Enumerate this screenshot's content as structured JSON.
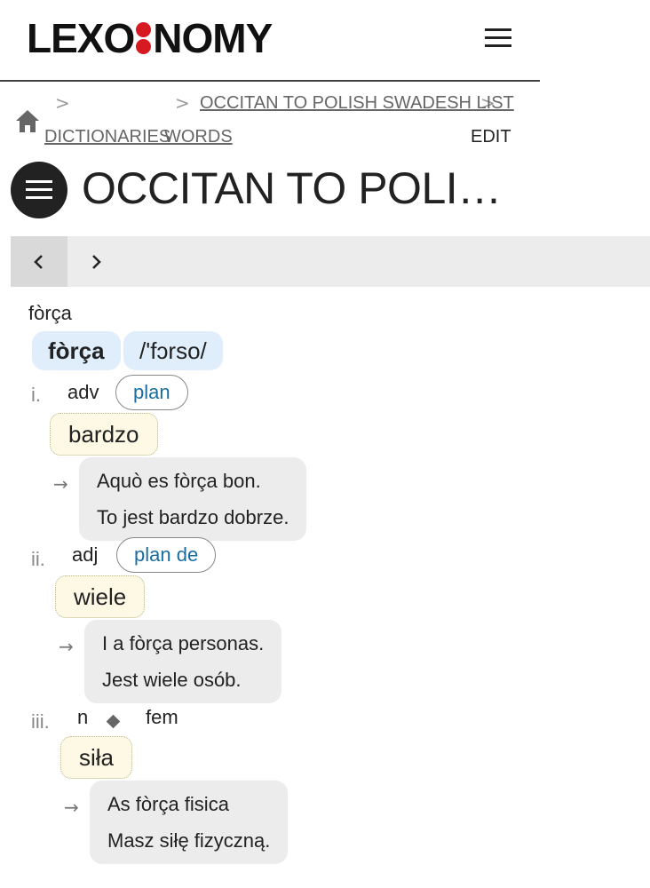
{
  "header": {
    "logo_left": "LEXO",
    "logo_right": "NOMY"
  },
  "breadcrumb": {
    "dictionaries": "DICTIONARIES",
    "dictionary": "OCCITAN TO POLISH SWADESH LIST",
    "words": "WORDS",
    "edit": "EDIT",
    "separator": ">"
  },
  "page_title": "OCCITAN TO POLISH S…",
  "entry": {
    "headword_plain": "fòrça",
    "headword": "fòrça",
    "pronunciation": "/'fɔrso/",
    "senses": [
      {
        "number": "i.",
        "pos": "adv",
        "translation_link": "plan",
        "equivalent": "bardzo",
        "example_source": "Aquò es fòrça bon.",
        "example_target": "To jest bardzo dobrze."
      },
      {
        "number": "ii.",
        "pos": "adj",
        "translation_link": "plan de",
        "equivalent": "wiele",
        "example_source": "I a fòrça personas.",
        "example_target": "Jest wiele osób."
      },
      {
        "number": "iii.",
        "pos": "n",
        "gender": "fem",
        "equivalent": "siła",
        "example_source": "As fòrça fisica",
        "example_target": "Masz siłę fizyczną."
      }
    ],
    "arrow": "→"
  },
  "colors": {
    "logo_accent": "#d71921",
    "link": "#1a6da0",
    "headword_bg": "#e0eefc",
    "equivalent_bg": "#fdf9e4",
    "example_bg": "#ececec"
  },
  "icons": [
    "hamburger-menu-icon",
    "home-icon",
    "chevron-right-icon",
    "chevron-left-icon",
    "diamond-icon"
  ]
}
